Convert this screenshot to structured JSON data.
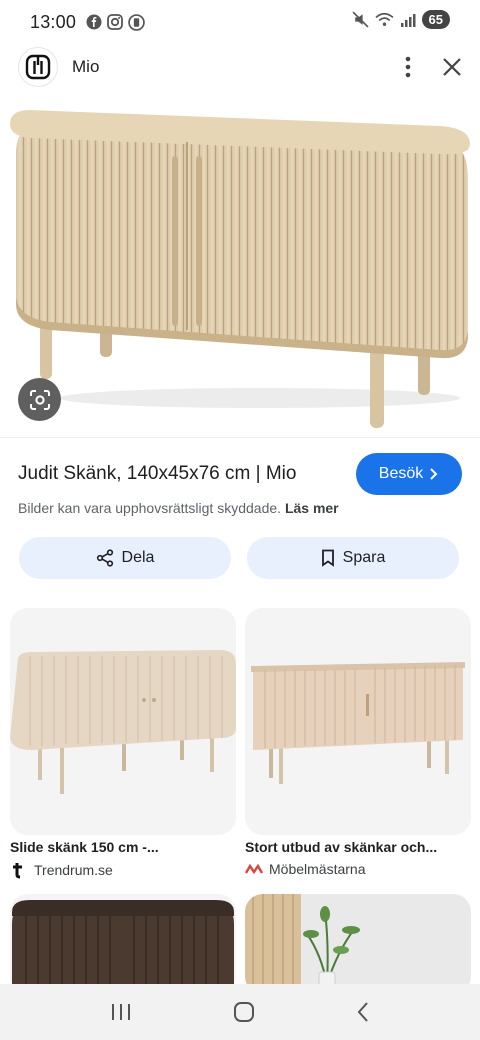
{
  "status_bar": {
    "time": "13:00",
    "battery": "65",
    "icons": [
      "facebook-icon",
      "instagram-icon",
      "app-icon",
      "mute-icon",
      "wifi-icon",
      "signal-icon"
    ]
  },
  "header": {
    "site_name": "Mio",
    "icons": [
      "mio-logo-icon",
      "more-vert-icon",
      "close-icon"
    ]
  },
  "result": {
    "title": "Judit Skänk, 140x45x76 cm | Mio",
    "visit_label": "Besök",
    "notice_text": "Bilder kan vara upphovsrättsligt skyddade.",
    "notice_link": "Läs mer",
    "share_label": "Dela",
    "save_label": "Spara"
  },
  "related": [
    {
      "title": "Slide skänk 150 cm -...",
      "source": "Trendrum.se",
      "icon": "trendrum-logo-icon"
    },
    {
      "title": "Stort utbud av skänkar och...",
      "source": "Möbelmästarna",
      "icon": "mobelmastarna-logo-icon"
    }
  ],
  "colors": {
    "accent": "#1a73e8",
    "action_bg": "#e8effd",
    "wood_light": "#e2d2b4",
    "wood_dark": "#4a3a30"
  }
}
